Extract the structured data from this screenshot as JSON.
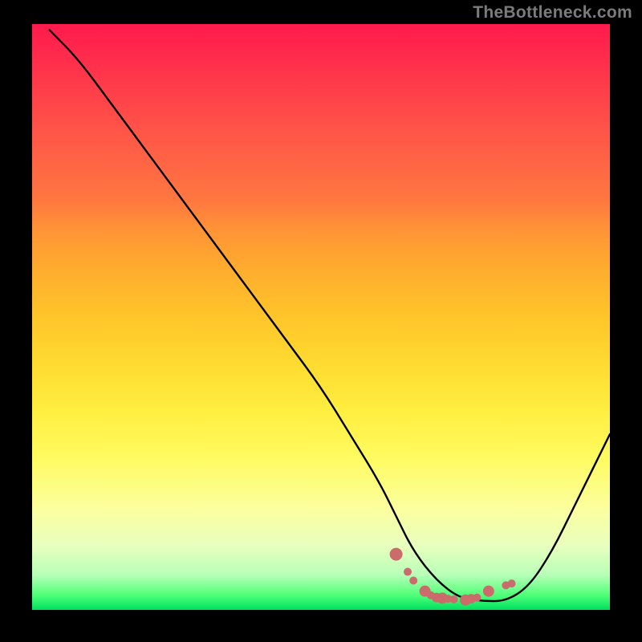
{
  "watermark": "TheBottleneck.com",
  "chart_data": {
    "type": "line",
    "title": "",
    "xlabel": "",
    "ylabel": "",
    "xlim": [
      0,
      100
    ],
    "ylim": [
      0,
      100
    ],
    "grid": false,
    "series": [
      {
        "name": "curve",
        "color": "#000000",
        "x": [
          3,
          8,
          14,
          20,
          26,
          32,
          38,
          44,
          50,
          55,
          60,
          63,
          66,
          70,
          74,
          78,
          82,
          86,
          90,
          94,
          100
        ],
        "y": [
          99,
          94,
          86,
          78,
          70,
          62,
          54,
          46,
          38,
          30,
          22,
          16,
          10,
          5,
          2,
          1.5,
          1.5,
          4,
          10,
          18,
          30
        ]
      }
    ],
    "highlight_points": {
      "color": "#cc6b6b",
      "x": [
        63,
        65,
        66,
        68,
        69,
        70,
        71,
        72,
        73,
        75,
        76,
        77,
        79,
        82,
        83
      ],
      "y": [
        9.5,
        6.5,
        5,
        3.2,
        2.5,
        2.1,
        2.0,
        1.9,
        1.8,
        1.7,
        1.9,
        2.1,
        3.2,
        4.2,
        4.5
      ]
    }
  }
}
